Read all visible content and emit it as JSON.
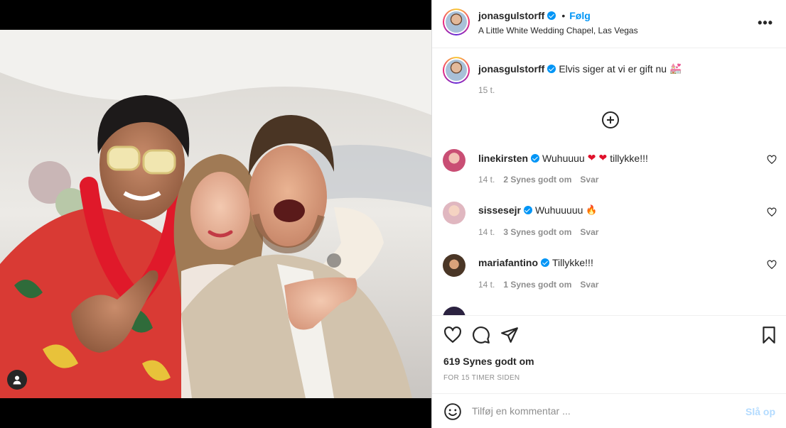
{
  "post": {
    "username": "jonasgulstorff",
    "separator": "•",
    "follow_label": "Følg",
    "location": "A Little White Wedding Chapel, Las Vegas",
    "more_label": "•••"
  },
  "caption": {
    "username": "jonasgulstorff",
    "text": "Elvis siger at vi er gift nu",
    "emoji": "💒",
    "time": "15 t."
  },
  "comments": [
    {
      "username": "linekirsten",
      "verified": true,
      "text_before": "Wuhuuuu",
      "emoji1": "❤",
      "emoji2": "❤",
      "text_after": "tillykke!!!",
      "time": "14 t.",
      "likes": "2 Synes godt om",
      "reply": "Svar"
    },
    {
      "username": "sissesejr",
      "verified": true,
      "text_before": "Wuhuuuuu",
      "emoji1": "🔥",
      "time": "14 t.",
      "likes": "3 Synes godt om",
      "reply": "Svar"
    },
    {
      "username": "mariafantino",
      "verified": true,
      "text_before": "Tillykke!!!",
      "time": "14 t.",
      "likes": "1 Synes godt om",
      "reply": "Svar"
    }
  ],
  "actions": {
    "like_count": "619 Synes godt om",
    "posted_ago": "FOR 15 TIMER SIDEN"
  },
  "composer": {
    "placeholder": "Tilføj en kommentar ...",
    "post_label": "Slå op"
  },
  "icons": {
    "like": "heart-icon",
    "comment": "comment-icon",
    "share": "send-icon",
    "save": "bookmark-icon",
    "emoji": "smiley-icon",
    "tag": "person-icon"
  },
  "colors": {
    "accent": "#0095f6",
    "muted": "#8e8e8e",
    "post_disabled": "#b3dbff"
  }
}
